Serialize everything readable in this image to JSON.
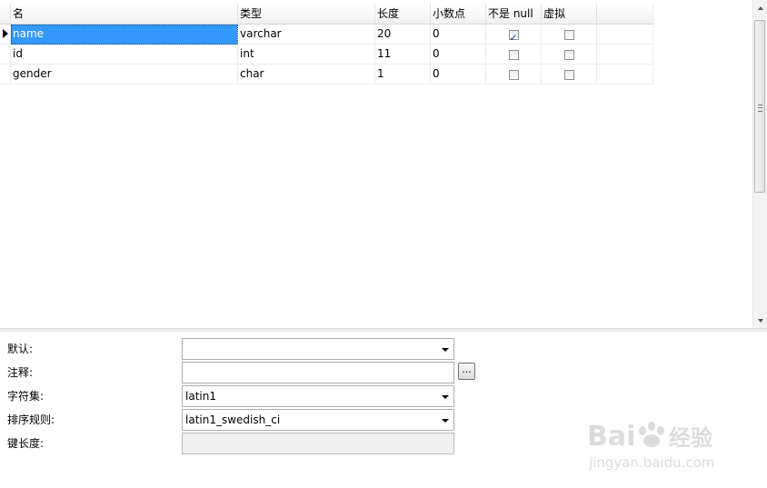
{
  "grid": {
    "columns": [
      "名",
      "类型",
      "长度",
      "小数点",
      "不是 null",
      "虚拟"
    ],
    "rows": [
      {
        "name": "name",
        "type": "varchar",
        "length": "20",
        "decimals": "0",
        "not_null": true,
        "virtual": false
      },
      {
        "name": "id",
        "type": "int",
        "length": "11",
        "decimals": "0",
        "not_null": false,
        "virtual": false
      },
      {
        "name": "gender",
        "type": "char",
        "length": "1",
        "decimals": "0",
        "not_null": false,
        "virtual": false
      }
    ],
    "selected_row": 0
  },
  "properties": {
    "default_label": "默认:",
    "default_value": "",
    "comment_label": "注释:",
    "comment_value": "",
    "comment_button": "...",
    "charset_label": "字符集:",
    "charset_value": "latin1",
    "collation_label": "排序规则:",
    "collation_value": "latin1_swedish_ci",
    "keylength_label": "键长度:",
    "keylength_value": ""
  },
  "watermark": {
    "brand": "Bai",
    "brand2": "du",
    "cn": "经验",
    "url": "jingyan.baidu.com"
  },
  "icons": [
    "row-pointer-icon",
    "checkbox-icon",
    "dropdown-arrow-icon",
    "scroll-up-icon",
    "scroll-down-icon"
  ]
}
